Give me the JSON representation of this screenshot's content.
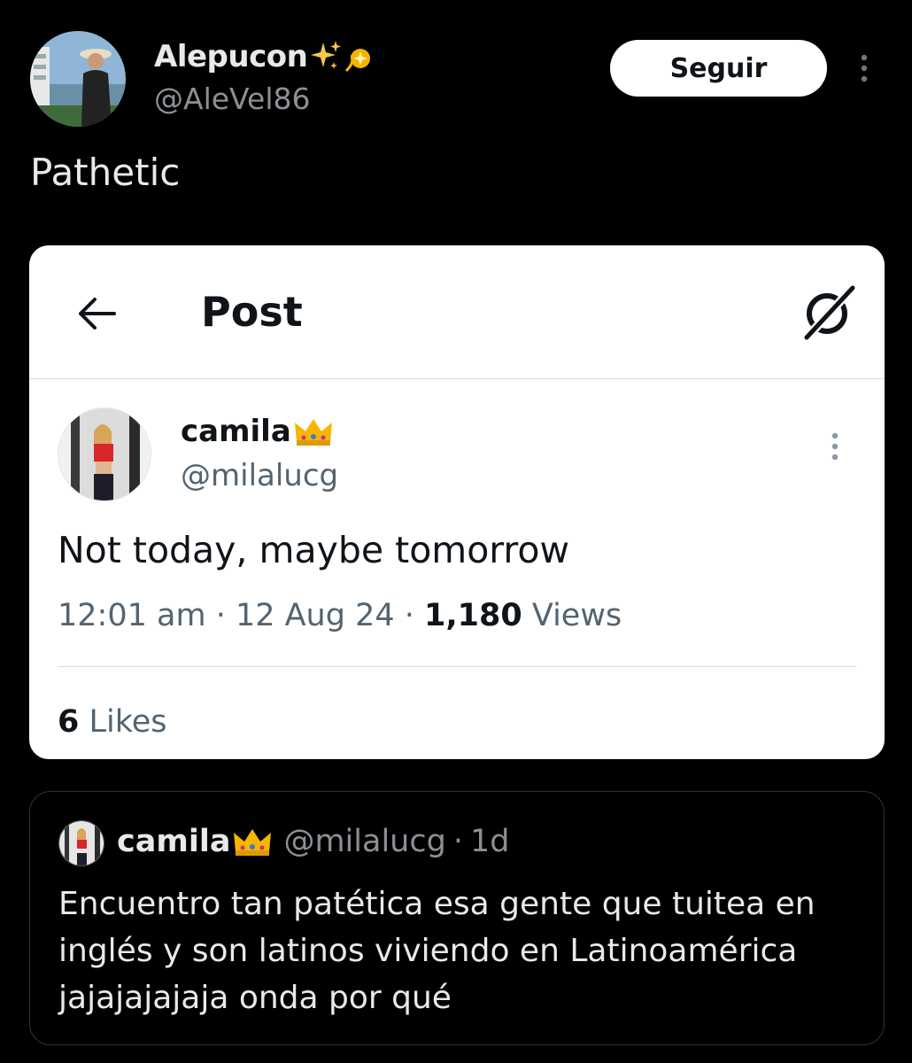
{
  "author": {
    "display_name": "Alepucon",
    "name_emojis": "✨💫",
    "handle": "@AleVel86",
    "follow_label": "Seguir"
  },
  "tweet": {
    "text": "Pathetic"
  },
  "embedded_post": {
    "header_title": "Post",
    "author_name": "camila",
    "author_emoji": "👑",
    "author_handle": "@milalucg",
    "text": "Not today, maybe tomorrow",
    "time": "12:01 am",
    "date": "12 Aug 24",
    "views_count": "1,180",
    "views_label": "Views",
    "likes_count": "6",
    "likes_label": "Likes"
  },
  "quoted_tweet": {
    "author_name": "camila",
    "author_emoji": "👑",
    "author_handle": "@milalucg",
    "separator": "·",
    "age": "1d",
    "text": "Encuentro tan patética esa gente que tuitea en inglés y son latinos viviendo en Latinoamérica jajajajajaja onda por qué"
  },
  "colors": {
    "background": "#000000",
    "card": "#ffffff",
    "primary_text_dark": "#e7e9ea",
    "secondary_text": "#8b9095"
  }
}
